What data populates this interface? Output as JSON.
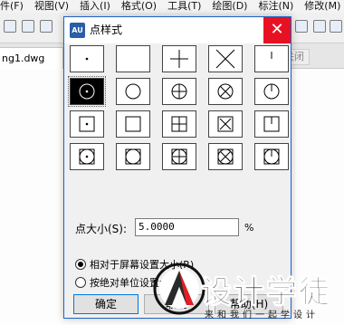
{
  "app": {
    "menu": [
      "件(F)",
      "视图(V)",
      "插入(I)",
      "格式(O)",
      "工具(T)",
      "绘图(D)",
      "标注(N)",
      "修改(M)"
    ],
    "document_tab": "ng1.dwg",
    "closed_tab": "关闭"
  },
  "dialog": {
    "title": "点样式",
    "close_label": "✕",
    "logo_text": "AU",
    "styles": [
      [
        "dot",
        "blank",
        "plus",
        "x",
        "tick"
      ],
      [
        "circle-dot",
        "circle",
        "circle-plus",
        "circle-x",
        "circle-tick"
      ],
      [
        "square-dot",
        "square",
        "square-plus",
        "square-x",
        "square-tick"
      ],
      [
        "square-circle-dot",
        "square-circle",
        "square-circle-plus",
        "square-circle-x",
        "square-circle-tick"
      ]
    ],
    "selected_style": "circle-dot",
    "point_size_label": "点大小(S):",
    "point_size_value": "5.0000",
    "point_size_unit": "%",
    "option_relative": "相对于屏幕设置大小(R)",
    "option_absolute": "按绝对单位设置大小(A)",
    "selected_option": "relative",
    "ok_label": "确定",
    "cancel_label": "取消",
    "help_label": "帮助(H)"
  },
  "watermark": {
    "title": "设计学徒",
    "subtitle": "来和我们一起学设计"
  },
  "colors": {
    "close_red": "#e81123",
    "accent_blue": "#0078d7",
    "dialog_bg": "#f0f0f0"
  }
}
